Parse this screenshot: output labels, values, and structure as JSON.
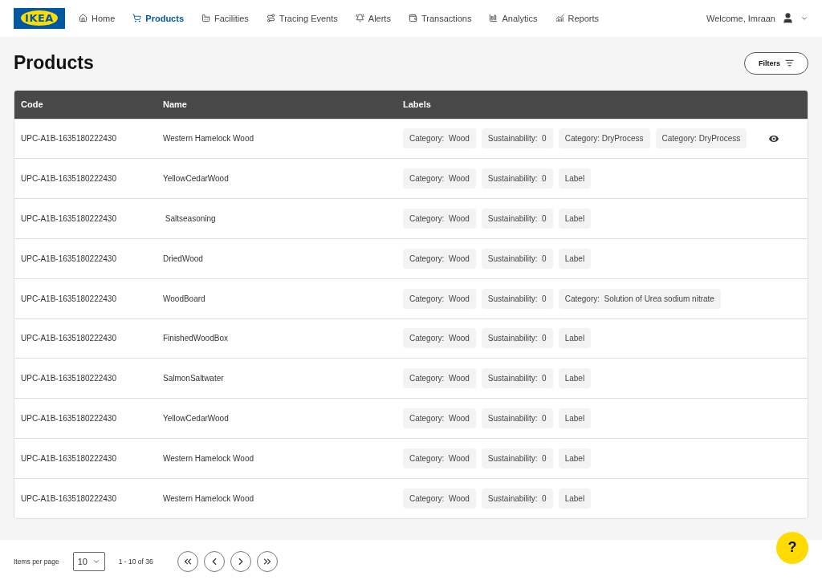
{
  "logo": "IKEA",
  "nav": [
    {
      "label": "Home",
      "selected": false
    },
    {
      "label": "Products",
      "selected": true
    },
    {
      "label": "Facilities",
      "selected": false
    },
    {
      "label": "Tracing Events",
      "selected": false
    },
    {
      "label": "Alerts",
      "selected": false
    },
    {
      "label": "Transactions",
      "selected": false
    },
    {
      "label": "Analytics",
      "selected": false
    },
    {
      "label": "Reports",
      "selected": false
    }
  ],
  "user": {
    "welcome": "Welcome, Imraan"
  },
  "page_title": "Products",
  "filters_button": "Filters",
  "table": {
    "columns": [
      "Code",
      "Name",
      "Labels"
    ],
    "rows": [
      {
        "code": "UPC-A1B-1635180222430",
        "name": "Western Hamelock Wood",
        "labels": [
          "Category:  Wood",
          "Sustainability:  0",
          "Category: DryProcess",
          "Category: DryProcess"
        ],
        "hovered": true
      },
      {
        "code": "UPC-A1B-1635180222430",
        "name": "YellowCedarWood",
        "labels": [
          "Category:  Wood",
          "Sustainability:  0",
          "Label"
        ],
        "hovered": false
      },
      {
        "code": "UPC-A1B-1635180222430",
        "name": " Saltseasoning",
        "labels": [
          "Category:  Wood",
          "Sustainability:  0",
          "Label"
        ],
        "hovered": false
      },
      {
        "code": "UPC-A1B-1635180222430",
        "name": "DriedWood",
        "labels": [
          "Category:  Wood",
          "Sustainability:  0",
          "Label"
        ],
        "hovered": false
      },
      {
        "code": "UPC-A1B-1635180222430",
        "name": "WoodBoard",
        "labels": [
          "Category:  Wood",
          "Sustainability:  0",
          "Category:  Solution of Urea sodium nitrate"
        ],
        "hovered": false
      },
      {
        "code": "UPC-A1B-1635180222430",
        "name": "FinishedWoodBox",
        "labels": [
          "Category:  Wood",
          "Sustainability:  0",
          "Label"
        ],
        "hovered": false
      },
      {
        "code": "UPC-A1B-1635180222430",
        "name": "SalmonSaltwater",
        "labels": [
          "Category:  Wood",
          "Sustainability:  0",
          "Label"
        ],
        "hovered": false
      },
      {
        "code": "UPC-A1B-1635180222430",
        "name": "YellowCedarWood",
        "labels": [
          "Category:  Wood",
          "Sustainability:  0",
          "Label"
        ],
        "hovered": false
      },
      {
        "code": "UPC-A1B-1635180222430",
        "name": "Western Hamelock Wood",
        "labels": [
          "Category:  Wood",
          "Sustainability:  0",
          "Label"
        ],
        "hovered": false
      },
      {
        "code": "UPC-A1B-1635180222430",
        "name": "Western Hamelock Wood",
        "labels": [
          "Category:  Wood",
          "Sustainability:  0",
          "Label"
        ],
        "hovered": false
      }
    ]
  },
  "pagination": {
    "items_per_page_label": "Items per page",
    "page_size": "10",
    "range": "1 - 10 of 36"
  },
  "help_button": "?"
}
